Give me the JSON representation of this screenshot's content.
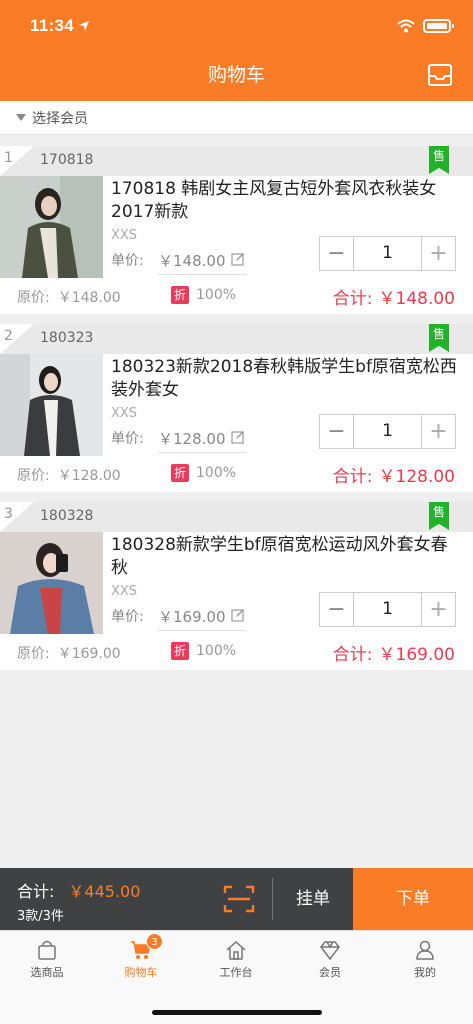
{
  "status_bar": {
    "time": "11:34"
  },
  "header": {
    "title": "购物车",
    "inbox_icon": "inbox-icon"
  },
  "member": {
    "label": "选择会员"
  },
  "items": [
    {
      "index": "1",
      "code": "170818",
      "sold_tag": "售",
      "name": "170818 韩剧女主风复古短外套风衣秋装女2017新款",
      "size": "XXS",
      "unit_label": "单价:",
      "unit_price": "￥148.00",
      "quantity": "1",
      "orig_label": "原价:",
      "orig_price": "￥148.00",
      "discount_badge": "折",
      "discount": "100%",
      "subtotal_label": "合计:",
      "subtotal": "￥148.00"
    },
    {
      "index": "2",
      "code": "180323",
      "sold_tag": "售",
      "name": "180323新款2018春秋韩版学生bf原宿宽松西装外套女",
      "size": "XXS",
      "unit_label": "单价:",
      "unit_price": "￥128.00",
      "quantity": "1",
      "orig_label": "原价:",
      "orig_price": "￥128.00",
      "discount_badge": "折",
      "discount": "100%",
      "subtotal_label": "合计:",
      "subtotal": "￥128.00"
    },
    {
      "index": "3",
      "code": "180328",
      "sold_tag": "售",
      "name": "180328新款学生bf原宿宽松运动风外套女春秋",
      "size": "XXS",
      "unit_label": "单价:",
      "unit_price": "￥169.00",
      "quantity": "1",
      "orig_label": "原价:",
      "orig_price": "￥169.00",
      "discount_badge": "折",
      "discount": "100%",
      "subtotal_label": "合计:",
      "subtotal": "￥169.00"
    }
  ],
  "footer": {
    "total_label": "合计:",
    "total_amount": "￥445.00",
    "count": "3款/3件",
    "hang_label": "挂单",
    "order_label": "下单"
  },
  "tabs": [
    {
      "label": "选商品",
      "icon": "bag-icon"
    },
    {
      "label": "购物车",
      "icon": "cart-icon",
      "badge": "3",
      "active": true
    },
    {
      "label": "工作台",
      "icon": "home-icon"
    },
    {
      "label": "会员",
      "icon": "diamond-icon"
    },
    {
      "label": "我的",
      "icon": "user-icon"
    }
  ],
  "colors": {
    "accent": "#fb7c26",
    "price_red": "#e93d4f",
    "sold_green": "#22b22a",
    "bar_dark": "#3f4143"
  }
}
